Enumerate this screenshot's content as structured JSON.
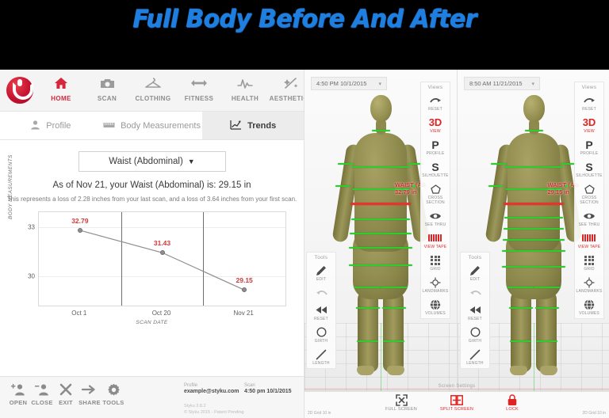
{
  "banner": {
    "title": "Full Body Before And After"
  },
  "topnav": {
    "logo_name": "styku-logo",
    "items": [
      {
        "label": "HOME",
        "icon": "home-icon",
        "glyph": "⌂",
        "active": true
      },
      {
        "label": "SCAN",
        "icon": "camera-icon",
        "glyph": "▣",
        "active": false
      },
      {
        "label": "CLOTHING",
        "icon": "hanger-icon",
        "glyph": "☉",
        "active": false
      },
      {
        "label": "FITNESS",
        "icon": "arrows-horizontal-icon",
        "glyph": "↔",
        "active": false
      },
      {
        "label": "HEALTH",
        "icon": "heartbeat-icon",
        "glyph": "⌇",
        "active": false
      },
      {
        "label": "AESTHETICS",
        "icon": "sparkle-icon",
        "glyph": "✂",
        "active": false
      }
    ]
  },
  "tabs": [
    {
      "label": "Profile",
      "icon": "person-icon",
      "glyph": "♟",
      "active": false
    },
    {
      "label": "Body Measurements",
      "icon": "ruler-icon",
      "glyph": "░",
      "active": false
    },
    {
      "label": "Trends",
      "icon": "line-chart-icon",
      "glyph": "↗",
      "active": true
    }
  ],
  "measurement_select": {
    "value": "Waist (Abdominal)",
    "caret": "▼"
  },
  "summary": {
    "headline": "As of Nov 21, your Waist (Abdominal) is: 29.15 in",
    "detail": "This represents a loss of 2.28 inches from your last scan, and a loss of 3.64 inches from your first scan."
  },
  "chart_data": {
    "type": "line",
    "title": "",
    "xlabel": "SCAN DATE",
    "ylabel": "BODY MEASUREMENTS",
    "categories": [
      "Oct 1",
      "Oct 20",
      "Nov 21"
    ],
    "values": [
      32.79,
      31.43,
      29.15
    ],
    "point_labels": [
      "32.79",
      "31.43",
      "29.15"
    ],
    "yticks": [
      30,
      33
    ],
    "ytick_labels": [
      "30",
      "33"
    ],
    "ylim": [
      28.2,
      33.9
    ],
    "grid": true,
    "legend": "none",
    "series_color": "#8e8e8e",
    "label_color": "#d03a3a"
  },
  "bottombar": {
    "tools": [
      {
        "label": "OPEN",
        "icon": "add-user-icon",
        "glyph": "♟"
      },
      {
        "label": "CLOSE",
        "icon": "remove-user-icon",
        "glyph": "♟"
      },
      {
        "label": "EXIT",
        "icon": "close-x-icon",
        "glyph": "✕"
      },
      {
        "label": "SHARE",
        "icon": "share-arrow-icon",
        "glyph": "→"
      },
      {
        "label": "TOOLS",
        "icon": "gear-icon",
        "glyph": "⚙"
      }
    ],
    "profile_key": "Profile",
    "profile_value": "example@styku.com",
    "scan_key": "Scan",
    "scan_value": "4:50 pm 10/1/2015",
    "version_line1": "Styku 3.8.2",
    "version_line2": "© Styku 2015 - Patent Pending"
  },
  "viewer": {
    "left": {
      "date": "4:50 PM 10/1/2015",
      "caret": "▾",
      "measure_name": "WAIST (AB",
      "measure_value": "32.79 in"
    },
    "right": {
      "date": "8:50 AM 11/21/2015",
      "caret": "▾",
      "measure_name": "WAIST (AB",
      "measure_value": "29.15 in"
    },
    "views_panel": {
      "title": "Views",
      "items": [
        {
          "label": "RESET",
          "icon": "reset-arrow-icon",
          "glyph": "➦",
          "accent": false
        },
        {
          "label": "VIEW",
          "icon": "three-d-icon",
          "glyph": "3D",
          "accent": true
        },
        {
          "label": "PROFILE",
          "icon": "profile-p-icon",
          "glyph": "P",
          "accent": false
        },
        {
          "label": "SILHOUETTE",
          "icon": "silhouette-s-icon",
          "glyph": "S",
          "accent": false
        },
        {
          "label": "CROSS SECTION",
          "icon": "pentagon-icon",
          "glyph": "⬠",
          "accent": false
        },
        {
          "label": "SEE THRU",
          "icon": "eye-icon",
          "glyph": "◉",
          "accent": false
        },
        {
          "label": "VIEW TAPE",
          "icon": "measuring-tape-icon",
          "glyph": "",
          "accent": true
        },
        {
          "label": "GRID",
          "icon": "grid-icon",
          "glyph": "",
          "accent": false
        },
        {
          "label": "LANDMARKS",
          "icon": "crosshair-icon",
          "glyph": "⌖",
          "accent": false
        },
        {
          "label": "VOLUMES",
          "icon": "globe-icon",
          "glyph": "⌖",
          "accent": false
        }
      ]
    },
    "tools_panel": {
      "title": "Tools",
      "items": [
        {
          "label": "EDIT",
          "icon": "pencil-icon",
          "glyph": "✎",
          "dim": false
        },
        {
          "label": "",
          "icon": "undo-icon",
          "glyph": "↶",
          "dim": true
        },
        {
          "label": "RESET",
          "icon": "rewind-icon",
          "glyph": "≪",
          "dim": false
        },
        {
          "label": "GIRTH",
          "icon": "circle-icon",
          "glyph": "◯",
          "dim": false
        },
        {
          "label": "LENGTH",
          "icon": "line-icon",
          "glyph": "╱",
          "dim": false
        }
      ]
    },
    "bottom": {
      "title": "Screen Settings",
      "items": [
        {
          "label": "FULL SCREEN",
          "icon": "expand-icon",
          "glyph": "⤢",
          "accent": false
        },
        {
          "label": "SPLIT SCREEN",
          "icon": "split-screen-icon",
          "glyph": "⧉",
          "accent": true
        },
        {
          "label": "LOCK",
          "icon": "lock-icon",
          "glyph": "ὑ2",
          "accent": true
        }
      ],
      "grid_note_left": "2D Grid 10 in",
      "grid_note_right": "2D Grid 10 in"
    }
  }
}
